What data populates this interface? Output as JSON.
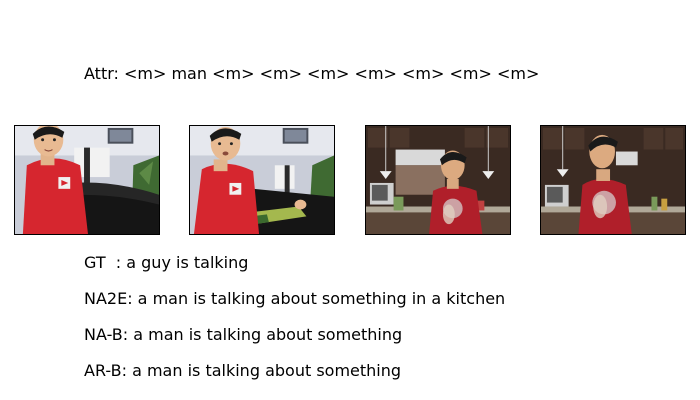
{
  "attr_line": "Attr: <m> man <m> <m> <m> <m> <m> <m> <m>",
  "frames": [
    {
      "scene": "man in red shirt on dark couch, living room"
    },
    {
      "scene": "man in red shirt on couch with person lying behind"
    },
    {
      "scene": "man in red shirt in kitchen"
    },
    {
      "scene": "man in red shirt in kitchen, closer"
    }
  ],
  "captions": {
    "gt": "GT  : a guy is talking",
    "na2e": "NA2E: a man is talking about something in a kitchen",
    "nab": "NA-B: a man is talking about something",
    "arb": "AR-B: a man is talking about something"
  }
}
